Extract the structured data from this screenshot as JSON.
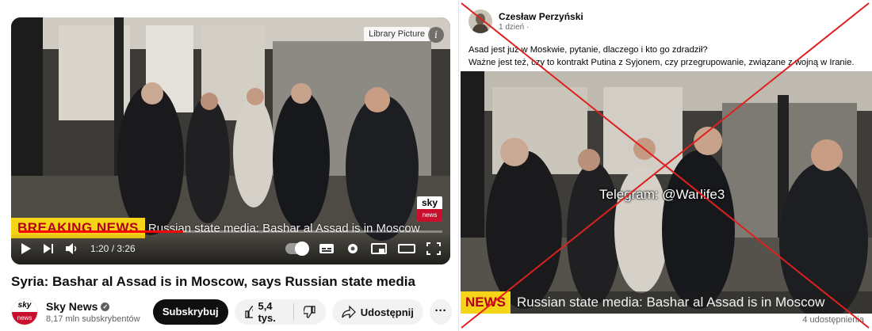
{
  "youtube": {
    "player": {
      "library_label": "Library Picture",
      "breaking_label": "BREAKING NEWS",
      "ticker_text": "Russian state media: Bashar al Assad is in Moscow",
      "channel_bug_top": "sky",
      "channel_bug_bottom": "news",
      "time_display": "1:20 / 3:26",
      "progress": 0.388
    },
    "video_title": "Syria: Bashar al Assad is in Moscow, says Russian state media",
    "channel": {
      "avatar_top": "sky",
      "avatar_bottom": "news",
      "name": "Sky News",
      "subscribers": "8,17 mln subskrybentów"
    },
    "actions": {
      "subscribe_label": "Subskrybuj",
      "like_count": "5,4 tys.",
      "share_label": "Udostępnij"
    }
  },
  "facebook": {
    "author": "Czesław Perzyński",
    "time": "1 dzień ·",
    "post_line1": "Asad jest już w Moskwie, pytanie, dlaczego i kto go zdradził?",
    "post_line2": "Ważne jest też, czy to kontrakt Putina z Syjonem, czy przegrupowanie, związane z wojną w Iranie.",
    "watermark": "Telegram: @Warlife3",
    "ticker_label": "NEWS",
    "ticker_text": "Russian state media: Bashar al Assad is in Moscow",
    "shares": "4 udostępnienia"
  },
  "colors": {
    "youtube_red": "#ff0000",
    "breaking_yellow": "#f6d417",
    "breaking_text": "#b3001b",
    "cross_red": "#e0201e"
  }
}
